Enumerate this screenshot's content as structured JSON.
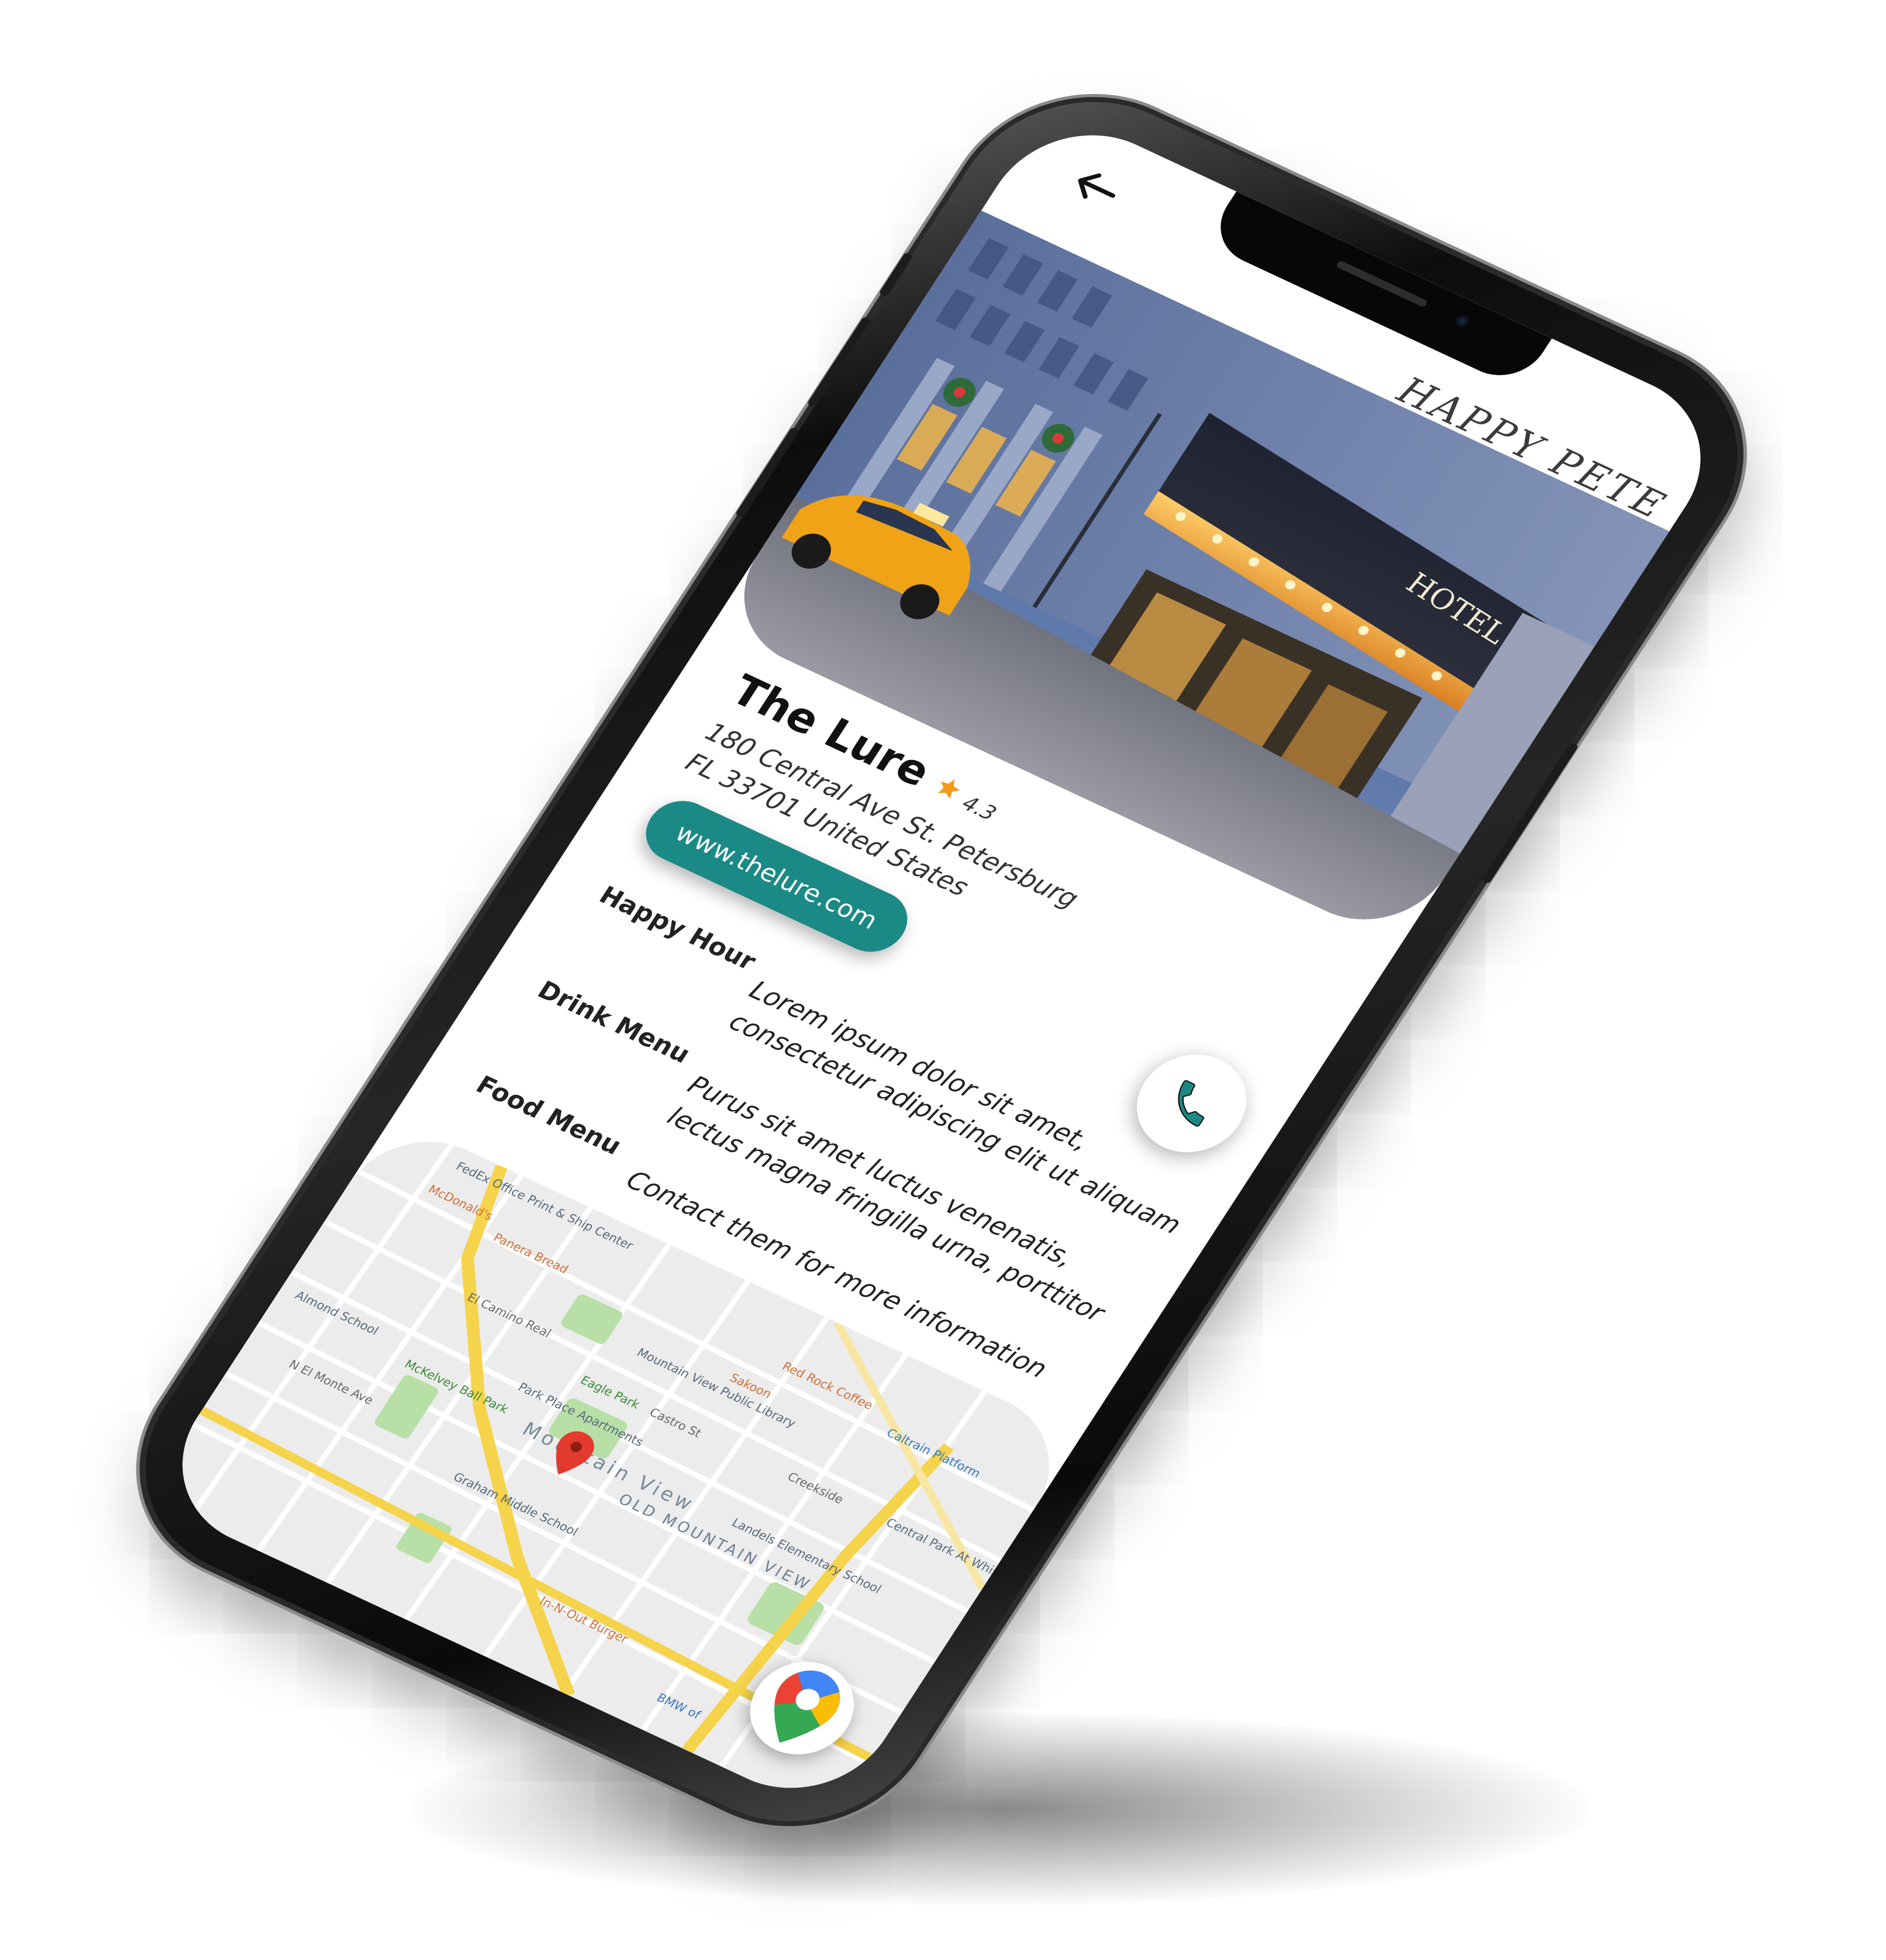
{
  "app": {
    "logo_text": "HAPPY PETE"
  },
  "hero": {
    "sign_text": "HOTEL"
  },
  "venue": {
    "name": "The Lure",
    "rating": "4.3",
    "address_line1": "180 Central Ave St. Petersburg",
    "address_line2": "FL 33701 United States",
    "website": "www.thelure.com"
  },
  "info": [
    {
      "label": "Happy Hour",
      "value": "Lorem ipsum dolor sit amet, consectetur adipiscing elit ut aliquam"
    },
    {
      "label": "Drink Menu",
      "value": "Purus sit amet luctus venenatis, lectus magna fringilla urna, porttitor"
    },
    {
      "label": "Food Menu",
      "value": "Contact them for more information"
    }
  ],
  "map": {
    "labels": {
      "fedex": "FedEx Office Print & Ship Center",
      "mcdonalds": "McDonald's",
      "paneras": "Panera Bread",
      "library": "Mountain View Public Library",
      "eagle_park": "Eagle Park",
      "park_place": "Park Place Apartments",
      "mckelvey": "McKelvey Ball Park",
      "city": "Mountain View",
      "old_mv": "OLD MOUNTAIN VIEW",
      "red_rock": "Red Rock Coffee",
      "sakoon": "Sakoon",
      "caltrain": "Caltrain Platform",
      "landels": "Landels Elementary School",
      "graham": "Graham Middle School",
      "almond": "Almond School",
      "central_park": "Central Park At Whisman Station",
      "in_n_out": "In-N-Out Burger",
      "bmw": "BMW of",
      "el_camino": "El Camino Real",
      "castro": "Castro St",
      "n_el_monte": "N El Monte Ave",
      "creekside": "Creekside"
    }
  },
  "colors": {
    "accent": "#1b8a86",
    "star": "#f29b1d",
    "map_road": "#f5d34a",
    "map_park": "#b7dfa6",
    "map_pin": "#e23b2e"
  },
  "icons": {
    "back": "arrow-left-icon",
    "star": "star-icon",
    "call": "phone-icon",
    "maps": "google-maps-icon",
    "pin": "map-pin-icon"
  }
}
